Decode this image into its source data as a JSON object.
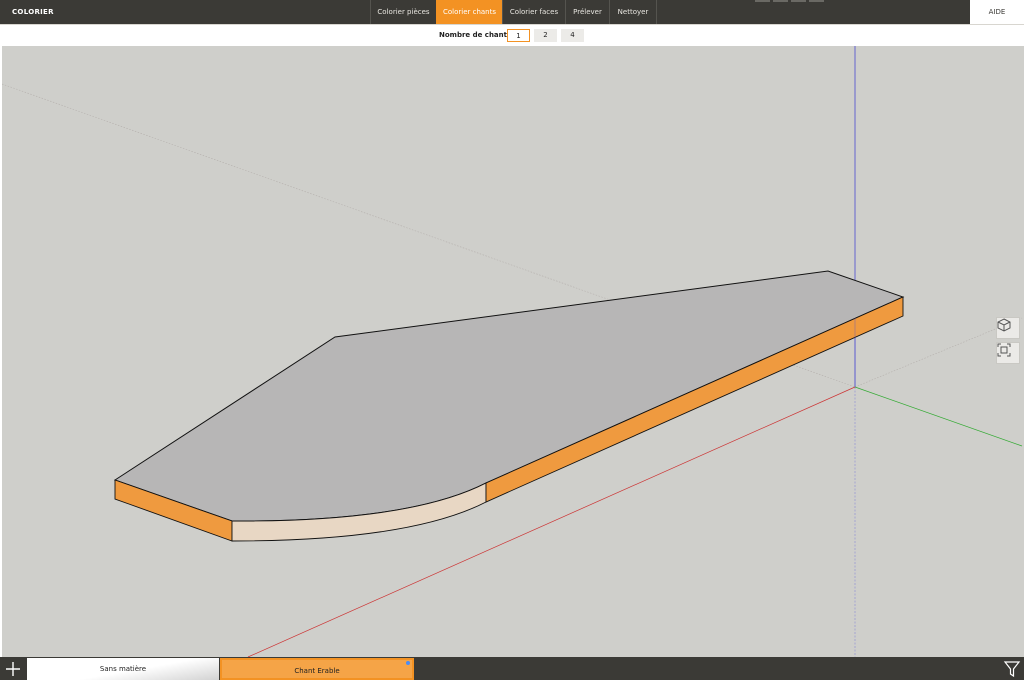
{
  "header": {
    "title": "COLORIER",
    "tabs": [
      {
        "label": "Colorier pièces",
        "active": false
      },
      {
        "label": "Colorier chants",
        "active": true
      },
      {
        "label": "Colorier faces",
        "active": false
      },
      {
        "label": "Prélever",
        "active": false
      },
      {
        "label": "Nettoyer",
        "active": false
      }
    ],
    "help_label": "AIDE"
  },
  "edge_selector": {
    "label": "Nombre de chants",
    "options": [
      "1",
      "2",
      "4"
    ],
    "selected": "1"
  },
  "viewport": {
    "tools": [
      "view-cube-icon",
      "zoom-extents-icon"
    ]
  },
  "materials": {
    "items": [
      {
        "label": "Sans matière",
        "selected": false
      },
      {
        "label": "Chant Erable",
        "selected": true
      }
    ],
    "add_icon": "plus-icon",
    "filter_icon": "filter-icon"
  },
  "colors": {
    "accent": "#f39223",
    "toolbar_bg": "#3b3a36",
    "viewport_bg": "#cfcfcb",
    "panel_top": "#b7b6b6",
    "edge_banded": "#ef9a3f",
    "edge_maple": "#e8d7c4",
    "axis_x": "#cc3333",
    "axis_y": "#33aa33",
    "axis_z": "#3333cc"
  }
}
